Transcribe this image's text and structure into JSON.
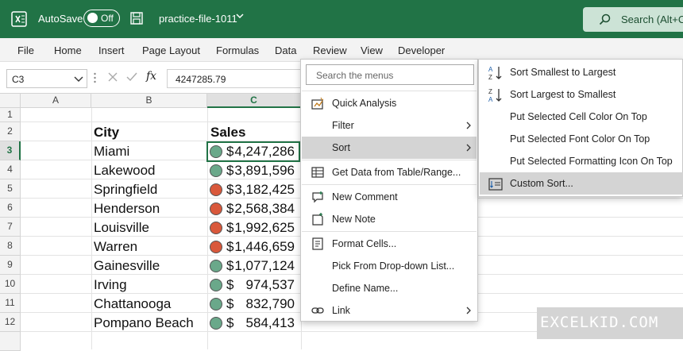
{
  "titlebar": {
    "autosave_label": "AutoSave",
    "autosave_state": "Off",
    "filename": "practice-file-1011",
    "search_label": "Search (Alt+C",
    "bg_color": "#217346"
  },
  "menubar": {
    "items": [
      "File",
      "Home",
      "Insert",
      "Page Layout",
      "Formulas",
      "Data",
      "Review",
      "View",
      "Developer"
    ]
  },
  "formula_bar": {
    "name_box": "C3",
    "value": "4247285.79"
  },
  "columns": [
    "A",
    "B",
    "C"
  ],
  "rows": [
    "1",
    "2",
    "3",
    "4",
    "5",
    "6",
    "7",
    "8",
    "9",
    "10",
    "11",
    "12"
  ],
  "sheet": {
    "headers": {
      "city": "City",
      "sales": "Sales"
    },
    "data": [
      {
        "city": "Miami",
        "currency": "$",
        "sales": "4,247,286",
        "indicator": "green"
      },
      {
        "city": "Lakewood",
        "currency": "$",
        "sales": "3,891,596",
        "indicator": "green"
      },
      {
        "city": "Springfield",
        "currency": "$",
        "sales": "3,182,425",
        "indicator": "red"
      },
      {
        "city": "Henderson",
        "currency": "$",
        "sales": "2,568,384",
        "indicator": "red"
      },
      {
        "city": "Louisville",
        "currency": "$",
        "sales": "1,992,625",
        "indicator": "red"
      },
      {
        "city": "Warren",
        "currency": "$",
        "sales": "1,446,659",
        "indicator": "red"
      },
      {
        "city": "Gainesville",
        "currency": "$",
        "sales": "1,077,124",
        "indicator": "green"
      },
      {
        "city": "Irving",
        "currency": "$",
        "sales": "974,537",
        "indicator": "green"
      },
      {
        "city": "Chattanooga",
        "currency": "$",
        "sales": "832,790",
        "indicator": "green"
      },
      {
        "city": "Pompano Beach",
        "currency": "$",
        "sales": "584,413",
        "indicator": "green"
      }
    ],
    "indicator_colors": {
      "green": "#6aa88a",
      "red": "#d9583b"
    }
  },
  "context_menu": {
    "search_placeholder": "Search the menus",
    "items": [
      {
        "label": "Quick Analysis",
        "icon": "quick-analysis-icon"
      },
      {
        "label": "Filter",
        "submenu": true
      },
      {
        "label": "Sort",
        "submenu": true,
        "highlighted": true
      },
      {
        "label": "Get Data from Table/Range...",
        "icon": "table-icon"
      },
      {
        "label": "New Comment",
        "icon": "comment-icon"
      },
      {
        "label": "New Note",
        "icon": "note-icon"
      },
      {
        "label": "Format Cells...",
        "icon": "format-cells-icon"
      },
      {
        "label": "Pick From Drop-down List..."
      },
      {
        "label": "Define Name..."
      },
      {
        "label": "Link",
        "icon": "link-icon",
        "submenu": true
      }
    ]
  },
  "sort_submenu": {
    "items": [
      {
        "label": "Sort Smallest to Largest",
        "icon": "sort-ascending-icon"
      },
      {
        "label": "Sort Largest to Smallest",
        "icon": "sort-descending-icon"
      },
      {
        "label": "Put Selected Cell Color On Top"
      },
      {
        "label": "Put Selected Font Color On Top"
      },
      {
        "label": "Put Selected Formatting Icon On Top"
      },
      {
        "label": "Custom Sort...",
        "icon": "custom-sort-icon",
        "highlighted": true
      }
    ]
  },
  "watermark": "EXCELKID.COM"
}
